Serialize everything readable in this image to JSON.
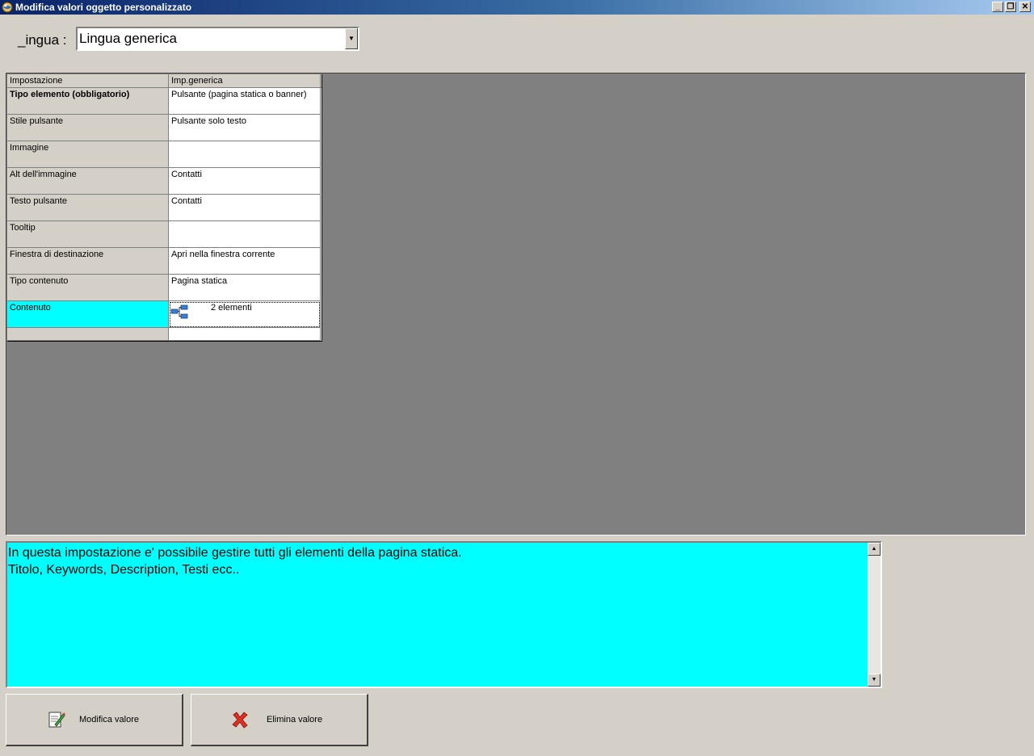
{
  "window": {
    "title": "Modifica valori oggetto personalizzato",
    "icon": "app-globe-icon",
    "controls": {
      "minimize": "_",
      "restore": "❐",
      "close": "✕"
    }
  },
  "language": {
    "label": "_ingua :",
    "selected": "Lingua generica"
  },
  "grid": {
    "headers": [
      "Impostazione",
      "Imp.generica"
    ],
    "rows": [
      {
        "key": "Tipo elemento (obbligatorio)",
        "value": "Pulsante (pagina statica o banner)"
      },
      {
        "key": "Stile pulsante",
        "value": "Pulsante solo testo"
      },
      {
        "key": "Immagine",
        "value": ""
      },
      {
        "key": "Alt dell'immagine",
        "value": "Contatti"
      },
      {
        "key": "Testo pulsante",
        "value": "Contatti"
      },
      {
        "key": "Tooltip",
        "value": ""
      },
      {
        "key": "Finestra di destinazione",
        "value": "Apri nella finestra corrente"
      },
      {
        "key": "Tipo contenuto",
        "value": "Pagina statica"
      },
      {
        "key": "Contenuto",
        "value": "2 elementi",
        "icon": "tree-structure-icon"
      }
    ]
  },
  "description": {
    "line1": "In questa impostazione e' possibile gestire tutti gli elementi della pagina statica.",
    "line2": "Titolo, Keywords, Description, Testi ecc.."
  },
  "buttons": {
    "edit": {
      "label": "Modifica valore",
      "icon": "edit-document-icon"
    },
    "delete": {
      "label": "Elimina valore",
      "icon": "red-x-icon"
    }
  },
  "colors": {
    "titlebar_start": "#0a246a",
    "titlebar_end": "#a6caf0",
    "selection": "#00ffff",
    "grid_background": "#808080",
    "window_background": "#d4d0c8"
  }
}
